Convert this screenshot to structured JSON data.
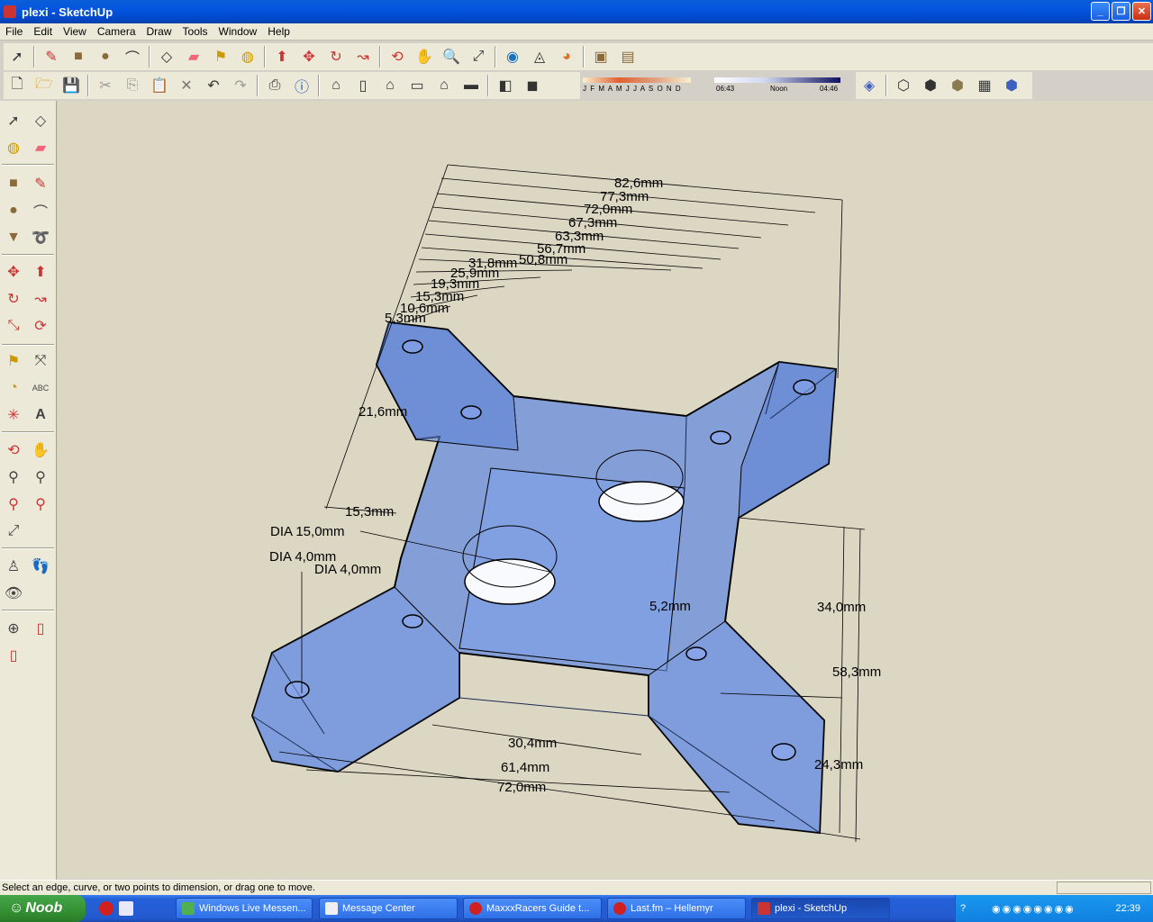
{
  "window": {
    "title": "plexi - SketchUp",
    "minimize": "_",
    "restore": "❐",
    "close": "✕"
  },
  "menu": [
    "File",
    "Edit",
    "View",
    "Camera",
    "Draw",
    "Tools",
    "Window",
    "Help"
  ],
  "shadow": {
    "months": "J F M A M J J A S O N D",
    "time_start": "06:43",
    "time_mid": "Noon",
    "time_end": "04:46"
  },
  "dimensions": {
    "top": [
      "82,6mm",
      "77,3mm",
      "72,0mm",
      "67,3mm",
      "63,3mm",
      "56,7mm",
      "50,8mm",
      "31,8mm",
      "25,9mm",
      "19,3mm",
      "15,3mm",
      "10,6mm",
      "5,3mm"
    ],
    "side_21": "21,6mm",
    "side_15": "15,3mm",
    "dia15": "DIA 15,0mm",
    "dia4a": "DIA 4,0mm",
    "dia4b": "DIA 4,0mm",
    "d52": "5,2mm",
    "d34": "34,0mm",
    "d583": "58,3mm",
    "d243": "24,3mm",
    "d304": "30,4mm",
    "d614": "61,4mm",
    "d720": "72,0mm"
  },
  "status": "Select an edge, curve, or two points to dimension, or drag one to move.",
  "taskbar": {
    "start": "Noob",
    "tasks": [
      "Windows Live Messen...",
      "Message Center",
      "MaxxxRacers Guide t...",
      "Last.fm – Hellemyr",
      "plexi - SketchUp"
    ],
    "clock": "22:39"
  }
}
